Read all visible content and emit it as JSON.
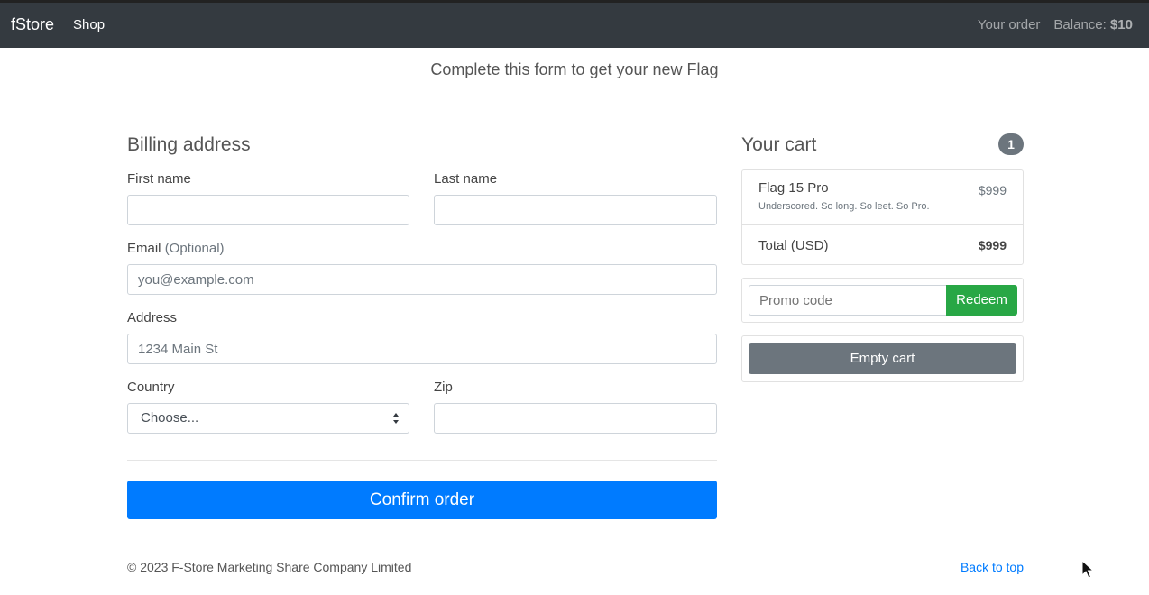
{
  "navbar": {
    "brand": "fStore",
    "shop": "Shop",
    "your_order": "Your order",
    "balance_label": "Balance:",
    "balance_value": "$10"
  },
  "subtitle": "Complete this form to get your new Flag",
  "billing": {
    "heading": "Billing address",
    "first_name_label": "First name",
    "last_name_label": "Last name",
    "email_label": "Email",
    "email_optional": "(Optional)",
    "email_placeholder": "you@example.com",
    "address_label": "Address",
    "address_placeholder": "1234 Main St",
    "country_label": "Country",
    "country_selected": "Choose...",
    "zip_label": "Zip",
    "confirm_label": "Confirm order"
  },
  "cart": {
    "heading": "Your cart",
    "count": "1",
    "items": [
      {
        "name": "Flag 15 Pro",
        "description": "Underscored. So long. So leet. So Pro.",
        "price": "$999"
      }
    ],
    "total_label": "Total (USD)",
    "total_value": "$999",
    "promo_placeholder": "Promo code",
    "redeem_label": "Redeem",
    "empty_label": "Empty cart"
  },
  "footer": {
    "copyright": "© 2023 F-Store Marketing Share Company Limited",
    "back_to_top": "Back to top"
  }
}
